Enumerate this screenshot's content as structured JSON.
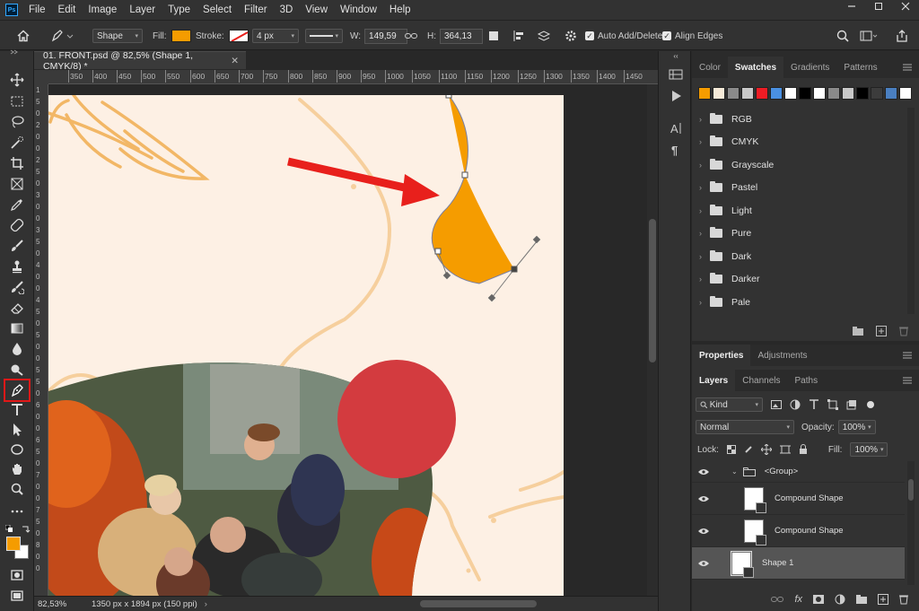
{
  "app": {
    "logo": "Ps",
    "menu": [
      "File",
      "Edit",
      "Image",
      "Layer",
      "Type",
      "Select",
      "Filter",
      "3D",
      "View",
      "Window",
      "Help"
    ]
  },
  "options_bar": {
    "mode": "Shape",
    "fill_label": "Fill:",
    "fill_color": "#f59c00",
    "stroke_label": "Stroke:",
    "stroke_width": "4 px",
    "w_label": "W:",
    "w_value": "149,59",
    "h_label": "H:",
    "h_value": "364,13",
    "auto_add_delete": "Auto Add/Delete",
    "align_edges": "Align Edges"
  },
  "document": {
    "tab_title": "01. FRONT.psd @ 82,5% (Shape 1, CMYK/8) *",
    "ruler_ticks": [
      "350",
      "400",
      "450",
      "500",
      "550",
      "600",
      "650",
      "700",
      "750",
      "800",
      "850",
      "900",
      "950",
      "1000",
      "1050",
      "1100",
      "1150",
      "1200",
      "1250",
      "1300",
      "1350",
      "1400",
      "1450"
    ],
    "ruler_v": [
      "1",
      "5",
      "0",
      "2",
      "0",
      "0",
      "2",
      "5",
      "0",
      "3",
      "0",
      "0",
      "3",
      "5",
      "0",
      "4",
      "0",
      "0",
      "4",
      "5",
      "0",
      "5",
      "0",
      "0",
      "5",
      "5",
      "0",
      "6",
      "0",
      "0",
      "6",
      "5",
      "0",
      "7",
      "0",
      "0",
      "7",
      "5",
      "0",
      "8",
      "0",
      "0"
    ],
    "zoom": "82,53%",
    "dimensions": "1350 px x 1894 px (150 ppi)"
  },
  "colors": {
    "foreground": "#f59c00",
    "background": "#ffffff",
    "shape_fill": "#f59c00",
    "circle": "#d33b3f",
    "arrow": "#e8201c",
    "artboard": "#fdf0e4",
    "lines": "#f6cf9d"
  },
  "swatches_panel": {
    "tabs": [
      "Color",
      "Swatches",
      "Gradients",
      "Patterns"
    ],
    "active_tab": "Swatches",
    "swatch_colors": [
      "#f59c00",
      "#f6ead8",
      "#8a8a8a",
      "#c8c8c8",
      "#ee1c24",
      "#4a90e2",
      "#ffffff",
      "#000000",
      "#ffffff",
      "#8a8a8a",
      "#c8c8c8",
      "#000000",
      "#3c3c3c",
      "#4a7fc1",
      "#ffffff"
    ],
    "folders": [
      "RGB",
      "CMYK",
      "Grayscale",
      "Pastel",
      "Light",
      "Pure",
      "Dark",
      "Darker",
      "Pale"
    ]
  },
  "properties_panel": {
    "tabs": [
      "Properties",
      "Adjustments"
    ],
    "active_tab": "Properties"
  },
  "layers_panel": {
    "tabs": [
      "Layers",
      "Channels",
      "Paths"
    ],
    "active_tab": "Layers",
    "filter_kind": "Kind",
    "blend_mode": "Normal",
    "opacity_label": "Opacity:",
    "opacity_value": "100%",
    "lock_label": "Lock:",
    "fill_label": "Fill:",
    "fill_value": "100%",
    "layers": [
      {
        "name": "<Group>",
        "type": "group"
      },
      {
        "name": "Compound Shape",
        "type": "shape"
      },
      {
        "name": "Compound Shape",
        "type": "shape"
      },
      {
        "name": "Shape 1",
        "type": "shape",
        "selected": true
      }
    ]
  }
}
